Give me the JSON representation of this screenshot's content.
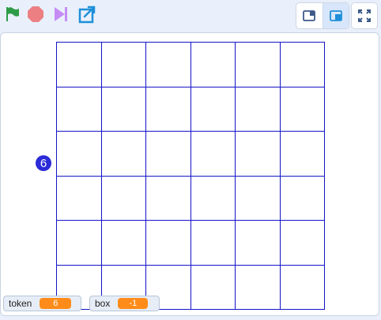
{
  "toolbar": {
    "icons": [
      "green-flag-icon",
      "stop-icon",
      "step-icon",
      "share-icon",
      "small-stage-icon",
      "large-stage-icon",
      "fullscreen-icon"
    ],
    "colors": {
      "flag": "#2e9c46",
      "stop": "#ec5959",
      "step": "#c68cf5",
      "share": "#1e8fd8",
      "layout_icon": "#3c5a8a",
      "active_layout": "#1e8fd8"
    }
  },
  "stage": {
    "grid": {
      "rows": 6,
      "cols": 6,
      "line_color": "#1414c8"
    },
    "sprite_label": "6"
  },
  "monitors": [
    {
      "label": "token",
      "value": "6"
    },
    {
      "label": "box",
      "value": "-1"
    }
  ]
}
